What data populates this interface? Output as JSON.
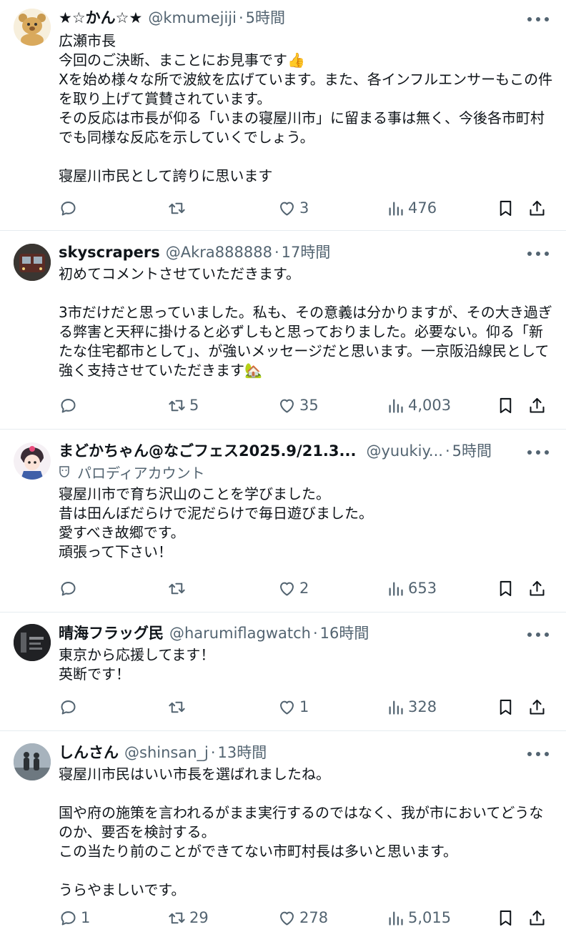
{
  "posts": [
    {
      "name": "★☆かん☆★",
      "handle": "@kmumejiji",
      "sep": "·",
      "time": "5時間",
      "text": "広瀬市長\n今回のご決断、まことにお見事です👍\nXを始め様々な所で波紋を広げています。また、各インフルエンサーもこの件を取り上げて賞賛されています。\nその反応は市長が仰る「いまの寝屋川市」に留まる事は無く、今後各市町村でも同様な反応を示していくでしょう。\n\n寝屋川市民として誇りに思います",
      "replies": "",
      "reposts": "",
      "likes": "3",
      "views": "476"
    },
    {
      "name": "skyscrapers",
      "handle": "@Akra888888",
      "sep": "·",
      "time": "17時間",
      "text": "初めてコメントさせていただきます。\n\n3市だけだと思っていました。私も、その意義は分かりますが、その大き過ぎる弊害と天秤に掛けると必ずしもと思っておりました。必要ない。仰る「新たな住宅都市として」、が強いメッセージだと思います。一京阪沿線民として強く支持させていただきます🏡",
      "replies": "",
      "reposts": "5",
      "likes": "35",
      "views": "4,003"
    },
    {
      "name": "まどかちゃん@なごフェス2025.9/21.3...",
      "handle": "@yuukiy...",
      "sep": "·",
      "time": "5時間",
      "badge": "パロディアカウント",
      "text": "寝屋川市で育ち沢山のことを学びました。\n昔は田んぼだらけで泥だらけで毎日遊びました。\n愛すべき故郷です。\n頑張って下さい！",
      "replies": "",
      "reposts": "",
      "likes": "2",
      "views": "653"
    },
    {
      "name": "晴海フラッグ民",
      "handle": "@harumiflagwatch",
      "sep": "·",
      "time": "16時間",
      "text": "東京から応援してます！\n英断です！",
      "replies": "",
      "reposts": "",
      "likes": "1",
      "views": "328"
    },
    {
      "name": "しんさん",
      "handle": "@shinsan_j",
      "sep": "·",
      "time": "13時間",
      "text": "寝屋川市民はいい市長を選ばれましたね。\n\n国や府の施策を言われるがまま実行するのではなく、我が市においてどうなのか、要否を検討する。\nこの当たり前のことができてない市町村長は多いと思います。\n\nうらやましいです。",
      "replies": "1",
      "reposts": "29",
      "likes": "278",
      "views": "5,015"
    }
  ],
  "colors": {
    "text": "#0f1419",
    "secondary": "#536471",
    "divider": "#e6ecf0"
  },
  "icons": [
    "reply-icon",
    "repost-icon",
    "like-icon",
    "views-icon",
    "bookmark-icon",
    "share-icon",
    "more-icon"
  ]
}
